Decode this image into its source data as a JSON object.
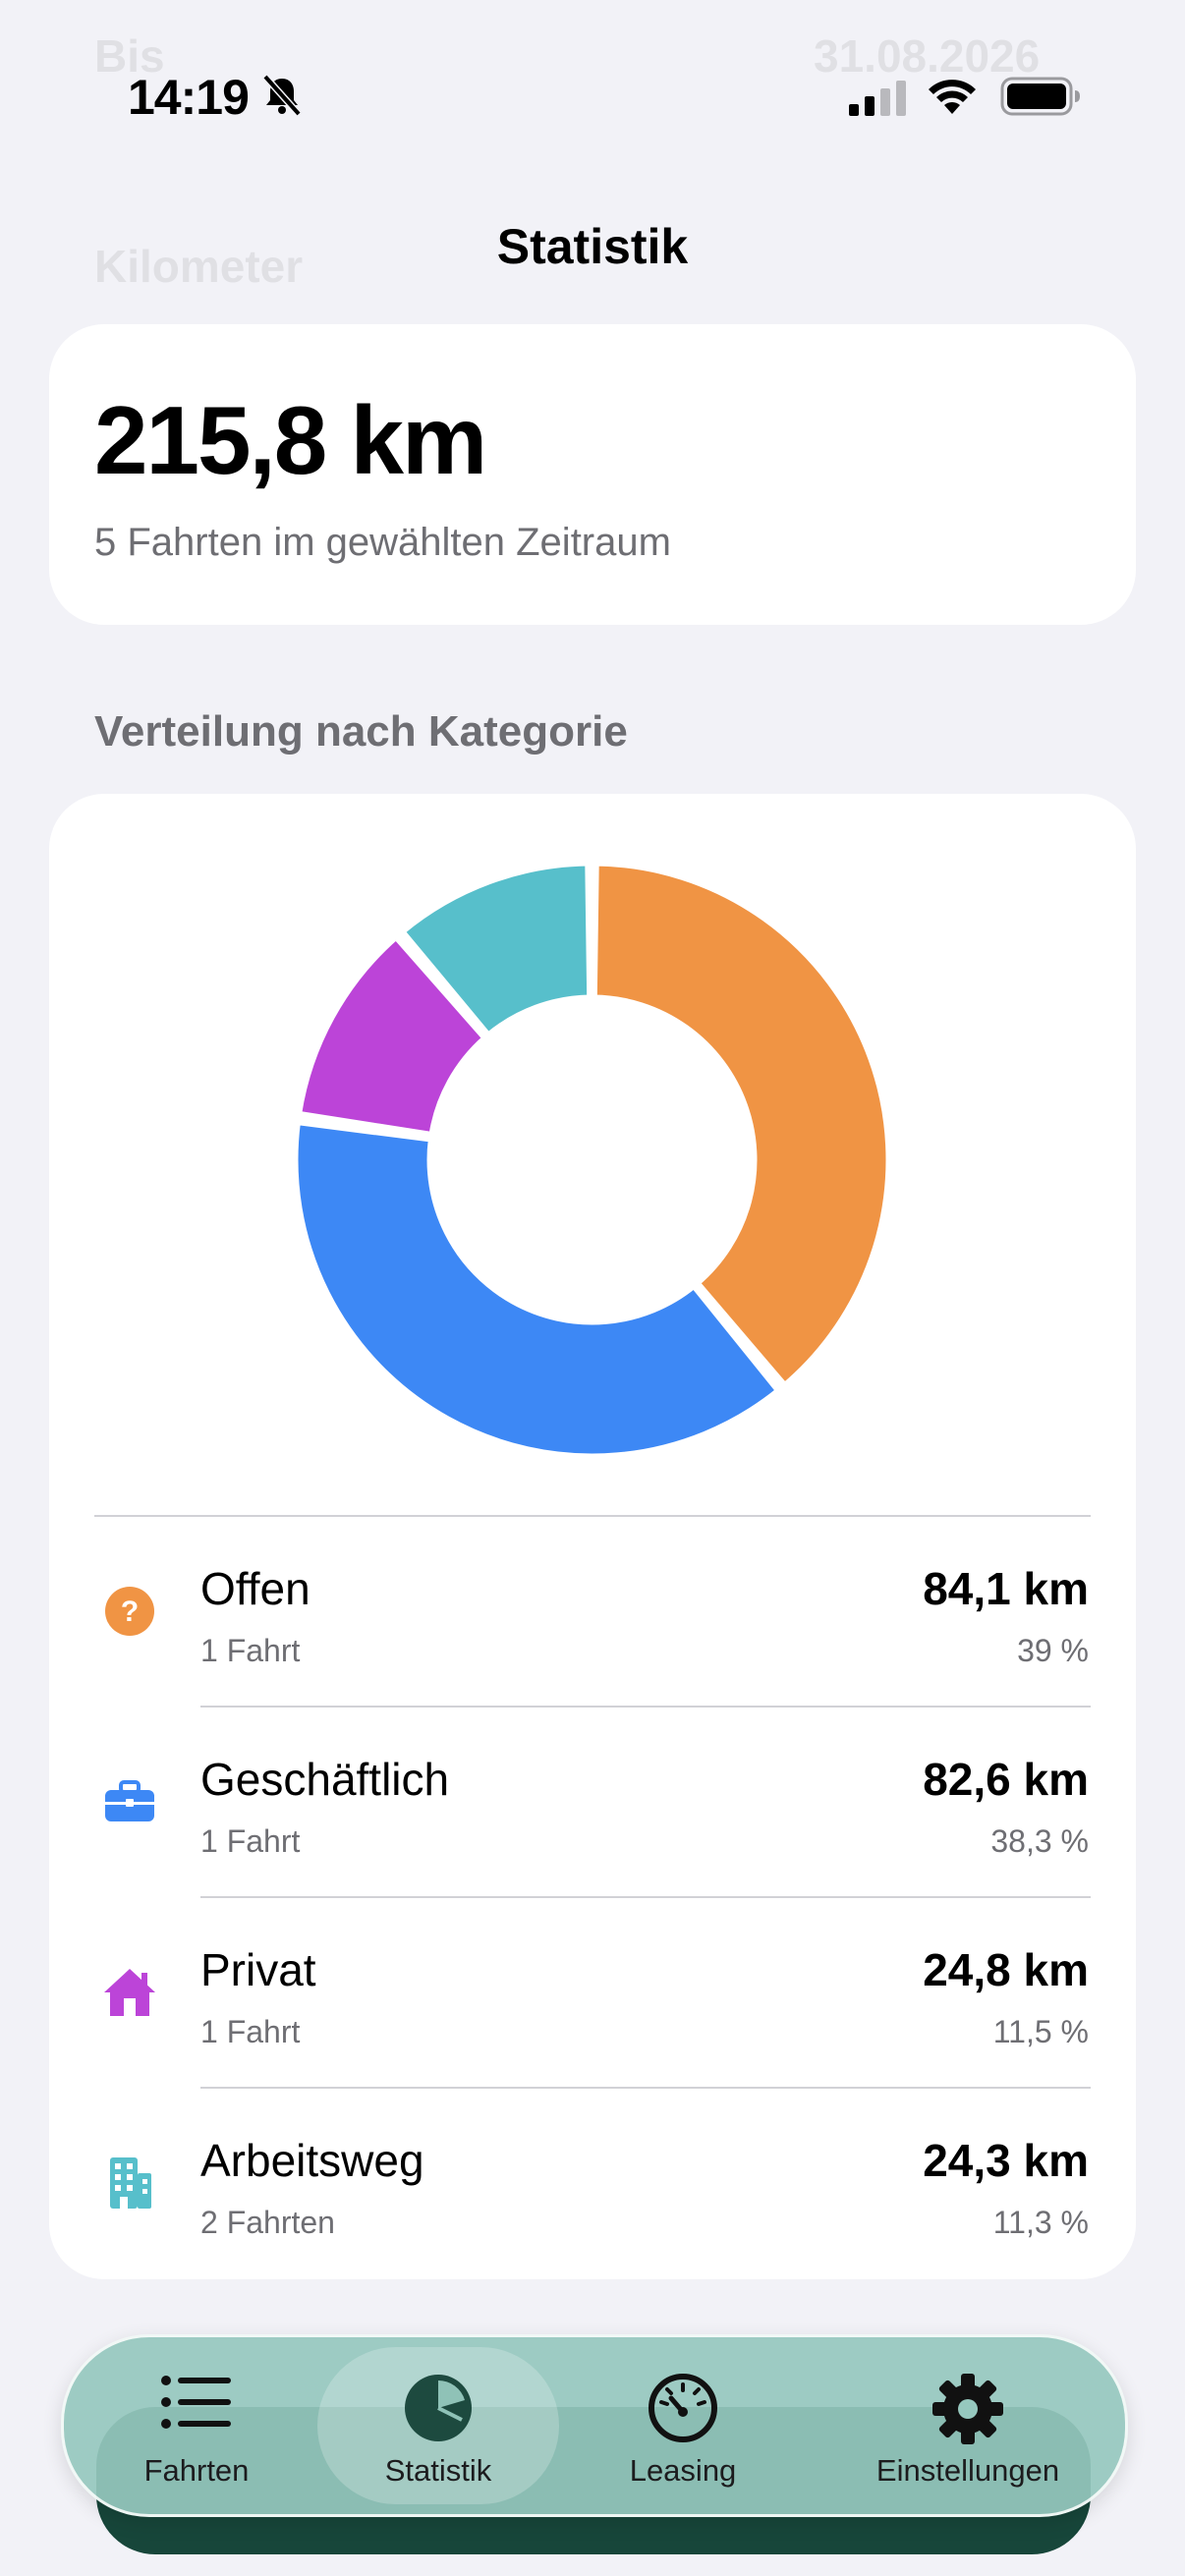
{
  "ghost": {
    "bis": "Bis",
    "date": "31.08.2026",
    "kilometer": "Kilometer"
  },
  "status_bar": {
    "time": "14:19"
  },
  "header": {
    "title": "Statistik"
  },
  "summary": {
    "total": "215,8 km",
    "subtitle": "5 Fahrten im gewählten Zeitraum"
  },
  "section": {
    "title": "Verteilung nach Kategorie"
  },
  "chart_data": {
    "type": "pie",
    "categories": [
      "Offen",
      "Geschäftlich",
      "Privat",
      "Arbeitsweg"
    ],
    "values": [
      84.1,
      82.6,
      24.8,
      24.3
    ],
    "colors": [
      "#F09444",
      "#3D88F5",
      "#BC44D8",
      "#57BFCB"
    ]
  },
  "categories": [
    {
      "name": "Offen",
      "trips": "1 Fahrt",
      "km": "84,1 km",
      "pct": "39 %",
      "icon": "question-circle-icon",
      "color": "#F09444"
    },
    {
      "name": "Geschäftlich",
      "trips": "1 Fahrt",
      "km": "82,6 km",
      "pct": "38,3 %",
      "icon": "briefcase-icon",
      "color": "#3D88F5"
    },
    {
      "name": "Privat",
      "trips": "1 Fahrt",
      "km": "24,8 km",
      "pct": "11,5 %",
      "icon": "house-icon",
      "color": "#BC44D8"
    },
    {
      "name": "Arbeitsweg",
      "trips": "2 Fahrten",
      "km": "24,3 km",
      "pct": "11,3 %",
      "icon": "office-building-icon",
      "color": "#57BFCB"
    }
  ],
  "tabbar": {
    "tabs": [
      {
        "label": "Fahrten",
        "icon": "list-icon"
      },
      {
        "label": "Statistik",
        "icon": "pie-chart-icon",
        "active": true
      },
      {
        "label": "Leasing",
        "icon": "speedometer-icon"
      },
      {
        "label": "Einstellungen",
        "icon": "gear-icon"
      }
    ]
  }
}
